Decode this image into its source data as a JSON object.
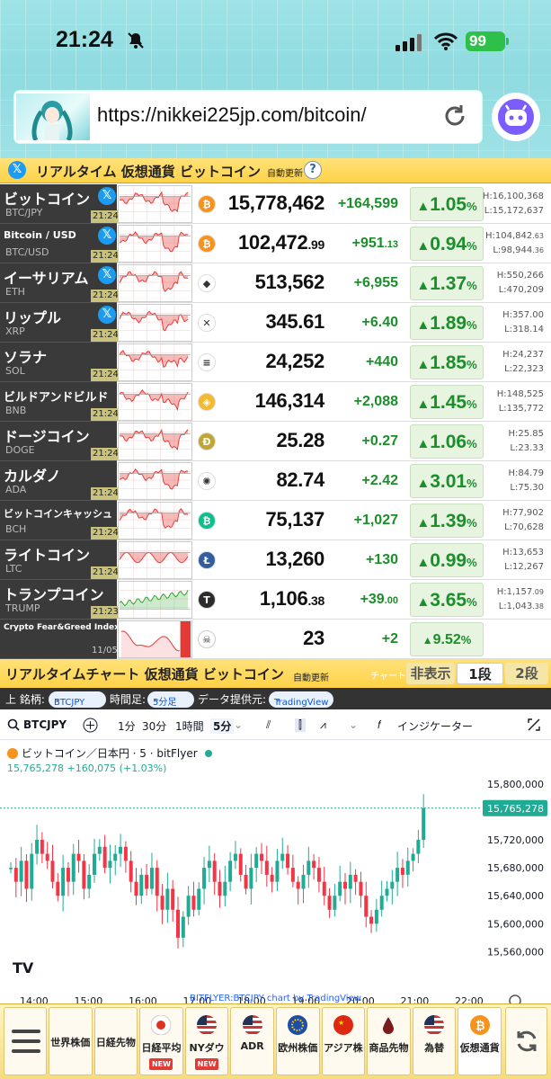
{
  "status": {
    "time": "21:24",
    "battery": "99"
  },
  "browser": {
    "url": "https://nikkei225jp.com/bitcoin/"
  },
  "header": {
    "title": "リアルタイム 仮想通貨 ビットコイン",
    "auto": "自動更新",
    "help": "?"
  },
  "rows": [
    {
      "name": "ビットコイン",
      "sym": "BTC/JPY",
      "x": true,
      "time": "21:24",
      "coin": "₿",
      "coin_color": "#f7931a",
      "price": "15,778,462",
      "price_dec": "",
      "chg": "+164,599",
      "chg_dec": "",
      "pct": "1.05",
      "high": "H:16,100,368",
      "high_dec": "",
      "low": "L:15,172,637",
      "low_dec": "",
      "trend": "down"
    },
    {
      "name": "Bitcoin / USD",
      "sym": "BTC/USD",
      "x": true,
      "time": "21:24",
      "coin": "₿",
      "coin_color": "#f7931a",
      "price": "102,472",
      "price_dec": ".99",
      "chg": "+951",
      "chg_dec": ".13",
      "pct": "0.94",
      "high": "H:104,842",
      "high_dec": ".63",
      "low": "L:98,944",
      "low_dec": ".36",
      "trend": "down"
    },
    {
      "name": "イーサリアム",
      "sym": "ETH",
      "x": true,
      "time": "21:24",
      "coin": "◆",
      "coin_color": "#ffffff",
      "price": "513,562",
      "price_dec": "",
      "chg": "+6,955",
      "chg_dec": "",
      "pct": "1.37",
      "high": "H:550,266",
      "high_dec": "",
      "low": "L:470,209",
      "low_dec": "",
      "trend": "down"
    },
    {
      "name": "リップル",
      "sym": "XRP",
      "x": true,
      "time": "21:24",
      "coin": "✕",
      "coin_color": "#ffffff",
      "price": "345.61",
      "price_dec": "",
      "chg": "+6.40",
      "chg_dec": "",
      "pct": "1.89",
      "high": "H:357.00",
      "high_dec": "",
      "low": "L:318.14",
      "low_dec": "",
      "trend": "down"
    },
    {
      "name": "ソラナ",
      "sym": "SOL",
      "x": false,
      "time": "21:24",
      "coin": "≡",
      "coin_color": "#ffffff",
      "price": "24,252",
      "price_dec": "",
      "chg": "+440",
      "chg_dec": "",
      "pct": "1.85",
      "high": "H:24,237",
      "high_dec": "",
      "low": "L:22,323",
      "low_dec": "",
      "trend": "down"
    },
    {
      "name": "ビルドアンドビルド",
      "sym": "BNB",
      "x": false,
      "time": "21:24",
      "coin": "◈",
      "coin_color": "#f3ba2f",
      "price": "146,314",
      "price_dec": "",
      "chg": "+2,088",
      "chg_dec": "",
      "pct": "1.45",
      "high": "H:148,525",
      "high_dec": "",
      "low": "L:135,772",
      "low_dec": "",
      "trend": "down"
    },
    {
      "name": "ドージコイン",
      "sym": "DOGE",
      "x": false,
      "time": "21:24",
      "coin": "Ð",
      "coin_color": "#c2a633",
      "price": "25.28",
      "price_dec": "",
      "chg": "+0.27",
      "chg_dec": "",
      "pct": "1.06",
      "high": "H:25.85",
      "high_dec": "",
      "low": "L:23.33",
      "low_dec": "",
      "trend": "down"
    },
    {
      "name": "カルダノ",
      "sym": "ADA",
      "x": false,
      "time": "21:24",
      "coin": "✺",
      "coin_color": "#ffffff",
      "price": "82.74",
      "price_dec": "",
      "chg": "+2.42",
      "chg_dec": "",
      "pct": "3.01",
      "high": "H:84.79",
      "high_dec": "",
      "low": "L:75.30",
      "low_dec": "",
      "trend": "down"
    },
    {
      "name": "ビットコインキャッシュ",
      "sym": "BCH",
      "x": false,
      "time": "21:24",
      "coin": "₿",
      "coin_color": "#0ac18e",
      "price": "75,137",
      "price_dec": "",
      "chg": "+1,027",
      "chg_dec": "",
      "pct": "1.39",
      "high": "H:77,902",
      "high_dec": "",
      "low": "L:70,628",
      "low_dec": "",
      "trend": "down"
    },
    {
      "name": "ライトコイン",
      "sym": "LTC",
      "x": false,
      "time": "21:24",
      "coin": "Ł",
      "coin_color": "#345d9d",
      "price": "13,260",
      "price_dec": "",
      "chg": "+130",
      "chg_dec": "",
      "pct": "0.99",
      "high": "H:13,653",
      "high_dec": "",
      "low": "L:12,267",
      "low_dec": "",
      "trend": "mixed"
    },
    {
      "name": "トランプコイン",
      "sym": "TRUMP",
      "x": false,
      "time": "21:23",
      "coin": "T",
      "coin_color": "#2b2b2b",
      "price": "1,106",
      "price_dec": ".38",
      "chg": "+39",
      "chg_dec": ".00",
      "pct": "3.65",
      "high": "H:1,157",
      "high_dec": ".09",
      "low": "L:1,043",
      "low_dec": ".38",
      "trend": "up"
    }
  ],
  "fear_greed": {
    "name": "Crypto Fear&Greed Index",
    "date": "11/05",
    "value": "23",
    "chg": "+2",
    "pct": "9.52"
  },
  "chart_section": {
    "title": "リアルタイムチャート 仮想通貨 ビットコイン",
    "auto": "自動更新",
    "chart_label": "チャート",
    "hide": "非表示",
    "one": "1段",
    "two": "2段"
  },
  "options": {
    "symbol_label": "上 銘柄:",
    "symbol": "BTCJPY",
    "tf_label": "時間足:",
    "tf": "5分足",
    "provider_label": "データ提供元:",
    "provider": "TradingView"
  },
  "tv": {
    "symbol": "BTCJPY",
    "tfs": [
      "1分",
      "30分",
      "1時間",
      "5分"
    ],
    "indicators": "インジケーター",
    "legend": "ビットコイン／日本円 · 5 · bitFlyer",
    "quote": "15,765,278 +160,075 (+1.03%)",
    "last": "15,765,278",
    "yticks": [
      "15,800,000",
      "15,720,000",
      "15,680,000",
      "15,640,000",
      "15,600,000",
      "15,560,000"
    ],
    "xticks": [
      "14:00",
      "15:00",
      "16:00",
      "17:00",
      "18:00",
      "19:00",
      "20:00",
      "21:00",
      "22:00"
    ],
    "credit": "BITFLYER:BTCJPY chart by TradingView"
  },
  "bottom_nav": [
    {
      "label": "世界株価",
      "flag": "",
      "new": false
    },
    {
      "label": "日経先物",
      "flag": "",
      "new": false
    },
    {
      "label": "日経平均",
      "flag": "jp",
      "new": true
    },
    {
      "label": "NYダウ",
      "flag": "us",
      "new": true
    },
    {
      "label": "ADR",
      "flag": "us",
      "new": false
    },
    {
      "label": "欧州株価",
      "flag": "eu",
      "new": false
    },
    {
      "label": "アジア株",
      "flag": "cn",
      "new": false
    },
    {
      "label": "商品先物",
      "flag": "oil",
      "new": false
    },
    {
      "label": "為替",
      "flag": "us",
      "new": false
    },
    {
      "label": "仮想通貨",
      "flag": "btc",
      "new": false
    }
  ],
  "chart_data": {
    "type": "candlestick",
    "title": "ビットコイン／日本円 · 5 · bitFlyer",
    "x_range": [
      "14:00",
      "22:00"
    ],
    "ylim": [
      15540000,
      15810000
    ],
    "last": 15765278,
    "closes": [
      15680000,
      15660000,
      15690000,
      15650000,
      15700000,
      15720000,
      15700000,
      15690000,
      15660000,
      15640000,
      15680000,
      15660000,
      15700000,
      15690000,
      15650000,
      15670000,
      15700000,
      15710000,
      15680000,
      15690000,
      15700000,
      15710000,
      15690000,
      15660000,
      15640000,
      15670000,
      15650000,
      15680000,
      15640000,
      15620000,
      15650000,
      15620000,
      15580000,
      15610000,
      15640000,
      15620000,
      15650000,
      15680000,
      15690000,
      15660000,
      15640000,
      15660000,
      15690000,
      15700000,
      15670000,
      15650000,
      15680000,
      15700000,
      15690000,
      15670000,
      15660000,
      15690000,
      15700000,
      15680000,
      15660000,
      15650000,
      15670000,
      15690000,
      15680000,
      15660000,
      15640000,
      15620000,
      15640000,
      15660000,
      15650000,
      15670000,
      15660000,
      15640000,
      15610000,
      15600000,
      15620000,
      15640000,
      15650000,
      15660000,
      15680000,
      15670000,
      15690000,
      15700000,
      15720000,
      15765278
    ]
  }
}
